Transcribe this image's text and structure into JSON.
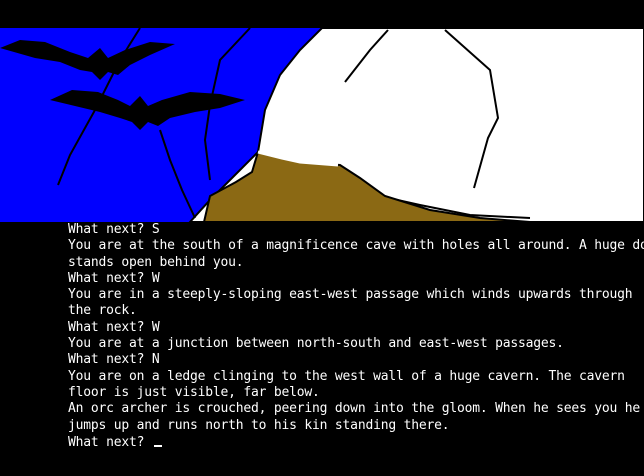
{
  "scene": {
    "name": "cavern-view",
    "colors": {
      "sky_wall": "#0000ff",
      "cliff": "#ffffff",
      "ledge": "#8b6914",
      "bats": "#000000",
      "outline": "#000000"
    }
  },
  "transcript": [
    {
      "type": "prompt",
      "prefix": "What next?",
      "command": "S"
    },
    {
      "type": "text",
      "text": "You are at the south of a magnificence cave with holes all around. A huge door"
    },
    {
      "type": "text",
      "text": "stands open behind you."
    },
    {
      "type": "prompt",
      "prefix": "What next?",
      "command": "W"
    },
    {
      "type": "text",
      "text": "You are in a steeply-sloping east-west passage which winds upwards through"
    },
    {
      "type": "text",
      "text": "the rock."
    },
    {
      "type": "prompt",
      "prefix": "What next?",
      "command": "W"
    },
    {
      "type": "text",
      "text": "You are at a junction between north-south and east-west passages."
    },
    {
      "type": "prompt",
      "prefix": "What next?",
      "command": "N"
    },
    {
      "type": "text",
      "text": "You are on a ledge clinging to the west wall of a huge cavern. The cavern"
    },
    {
      "type": "text",
      "text": "floor is just visible, far below."
    },
    {
      "type": "text",
      "text": "An orc archer is crouched, peering down into the gloom. When he sees you he"
    },
    {
      "type": "text",
      "text": "jumps up and runs north to his kin standing there."
    }
  ],
  "input": {
    "prefix": "What next?",
    "value": ""
  }
}
